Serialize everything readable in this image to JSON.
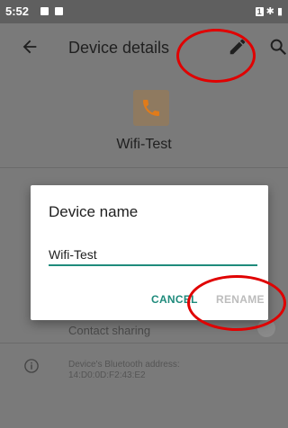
{
  "status_bar": {
    "time": "5:52",
    "sim_label": "1"
  },
  "app_bar": {
    "title": "Device details"
  },
  "device": {
    "name": "Wifi-Test"
  },
  "list": {
    "contact_sharing_label": "Contact sharing",
    "bt_address_label": "Device's Bluetooth address:",
    "bt_address_value": "14:D0:0D:F2:43:E2"
  },
  "dialog": {
    "title": "Device name",
    "input_value": "Wifi-Test",
    "cancel_label": "CANCEL",
    "rename_label": "RENAME"
  },
  "colors": {
    "accent": "#1f8b7c",
    "disabled": "#bdbdbd",
    "annotation": "#e00000",
    "avatar_bg": "#8f7a60",
    "phone_icon": "#e07b1a"
  },
  "icons": {
    "back": "arrow-left-icon",
    "edit": "pencil-icon",
    "search": "search-icon",
    "device": "phone-icon",
    "info": "info-icon"
  }
}
